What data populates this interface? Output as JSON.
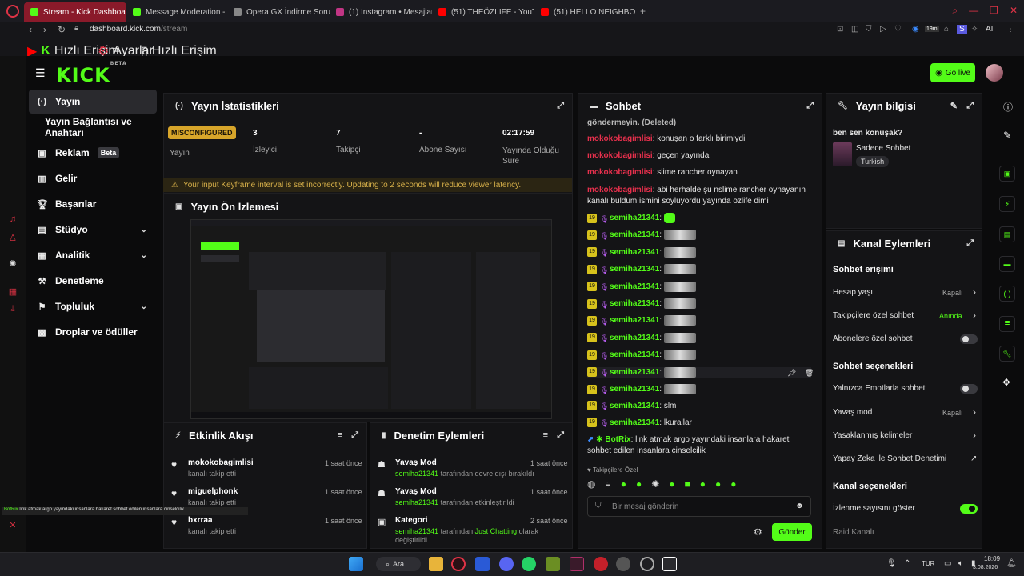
{
  "browser": {
    "tabs": [
      {
        "label": "Stream - Kick Dashboard",
        "color": "#53fc18"
      },
      {
        "label": "Message Moderation - Kic",
        "color": "#53fc18"
      },
      {
        "label": "Opera GX İndirme Sorunu",
        "color": "#888888"
      },
      {
        "label": "(1) Instagram • Mesajlar",
        "color": "#c13584"
      },
      {
        "label": "(51) THEÖZLIFE - YouTube",
        "color": "#ff0000"
      },
      {
        "label": "(51) HELLO NEIGHBOR OYN",
        "color": "#ff0000"
      }
    ],
    "new_tab": "+",
    "url_host": "dashboard.kick.com",
    "url_path": "/stream",
    "extension_badge": "19m",
    "extension_ai": "AI",
    "bookmarks": [
      "Hızlı Erişim",
      "Ayarlar",
      "Hızlı Erişim"
    ]
  },
  "header": {
    "logo": "KICK",
    "logo_beta": "BETA",
    "go_live": "Go live"
  },
  "sidebar": {
    "items": [
      {
        "label": "Yayın",
        "icon": "broadcast-icon",
        "active": true
      },
      {
        "label": "Yayın Bağlantısı ve Anahtarı",
        "icon": "",
        "active": false
      },
      {
        "label": "Reklam",
        "icon": "ad-icon",
        "badge": "Beta"
      },
      {
        "label": "Gelir",
        "icon": "revenue-icon"
      },
      {
        "label": "Başarılar",
        "icon": "trophy-icon"
      },
      {
        "label": "Stüdyo",
        "icon": "studio-icon",
        "chevron": true
      },
      {
        "label": "Analitik",
        "icon": "analytics-icon",
        "chevron": true
      },
      {
        "label": "Denetleme",
        "icon": "hammer-icon"
      },
      {
        "label": "Topluluk",
        "icon": "community-icon",
        "chevron": true
      },
      {
        "label": "Droplar ve ödüller",
        "icon": "gift-icon"
      }
    ]
  },
  "stats": {
    "title": "Yayın İstatistikleri",
    "status_badge": "MISCONFIGURED",
    "status_label": "Yayın",
    "viewers_value": "3",
    "viewers_label": "İzleyici",
    "followers_value": "7",
    "followers_label": "Takipçi",
    "subs_value": "-",
    "subs_label": "Abone Sayısı",
    "uptime_value": "02:17:59",
    "uptime_label": "Yayında Olduğu Süre",
    "warning": "Your input Keyframe interval is set incorrectly. Updating to 2 seconds will reduce viewer latency."
  },
  "preview": {
    "title": "Yayın Ön İzlemesi"
  },
  "activity": {
    "title": "Etkinlik Akışı",
    "items": [
      {
        "name": "mokokobagimlisi",
        "action": "kanalı takip etti",
        "time": "1 saat önce"
      },
      {
        "name": "miguelphonk",
        "action": "kanalı takip etti",
        "time": "1 saat önce"
      },
      {
        "name": "bxrraa",
        "action": "kanalı takip etti",
        "time": "1 saat önce"
      }
    ]
  },
  "moderation": {
    "title": "Denetim Eylemleri",
    "items": [
      {
        "title": "Yavaş Mod",
        "user": "semiha21341",
        "text": "tarafından devre dışı bırakıldı",
        "extra": "",
        "tail": "",
        "time": "1 saat önce"
      },
      {
        "title": "Yavaş Mod",
        "user": "semiha21341",
        "text": "tarafından etkinleştirildi",
        "extra": "",
        "tail": "",
        "time": "1 saat önce"
      },
      {
        "title": "Kategori",
        "user": "semiha21341",
        "text": "tarafından",
        "extra": "Just Chatting",
        "tail": "olarak değiştirildi",
        "time": "2 saat önce"
      }
    ]
  },
  "chat": {
    "title": "Sohbet",
    "deleted_line": "göndermeyin. (Deleted)",
    "messages": [
      {
        "user": "mokokobagimlisi",
        "text": ": konuşan o farklı birimiydi"
      },
      {
        "user": "mokokobagimlisi",
        "text": ": geçen yayında"
      },
      {
        "user": "mokokobagimlisi",
        "text": ": slime rancher oynayan"
      },
      {
        "user": "mokokobagimlisi",
        "text": ": abi herhalde şu nslime rancher oynayanın kanalı buldum ismini söylüyordu yayında özlife dimi"
      }
    ],
    "badge": "19",
    "emote_user": "semiha21341",
    "emote_rows": 11,
    "text_rows": [
      {
        "user": "semiha21341",
        "text": ": slm"
      },
      {
        "user": "semiha21341",
        "text": ": lkurallar"
      }
    ],
    "bot_user": "BotRix",
    "bot_text": ": link atmak argo yayındaki insanlara hakaret sohbet edilen insanlara cinselcilik",
    "followers_only": "Takipçilere Özel",
    "input_placeholder": "Bir mesaj gönderin",
    "send": "Gönder"
  },
  "stream_info": {
    "title": "Yayın bilgisi",
    "stream_title": "ben sen konuşak?",
    "category": "Sadece Sohbet",
    "language": "Turkish"
  },
  "channel_actions": {
    "title": "Kanal Eylemleri",
    "chat_access": "Sohbet erişimi",
    "account_age": "Hesap yaşı",
    "account_age_val": "Kapalı",
    "followers_chat": "Takipçilere özel sohbet",
    "followers_chat_val": "Anında",
    "subs_chat": "Abonelere özel sohbet",
    "chat_options": "Sohbet seçenekleri",
    "emotes_only": "Yalnızca Emotlarla sohbet",
    "slow_mode": "Yavaş mod",
    "slow_mode_val": "Kapalı",
    "banned_words": "Yasaklanmış kelimeler",
    "ai_moderation": "Yapay Zeka ile Sohbet Denetimi",
    "channel_options": "Kanal seçenekleri",
    "show_viewers": "İzlenme sayısını göster",
    "raid": "Raid Kanalı"
  },
  "overlay": {
    "user": "BotRix",
    "text": "link atmak argo yayındaki insanlara hakaret sohbet edilen insanlara cinselcilik"
  },
  "taskbar": {
    "search": "Ara",
    "lang": "TUR",
    "time": "18:09",
    "date": "3.08.2026"
  },
  "colors": {
    "accent": "#53fc18",
    "warning": "#d7a52a",
    "user_red": "#e8304d"
  }
}
